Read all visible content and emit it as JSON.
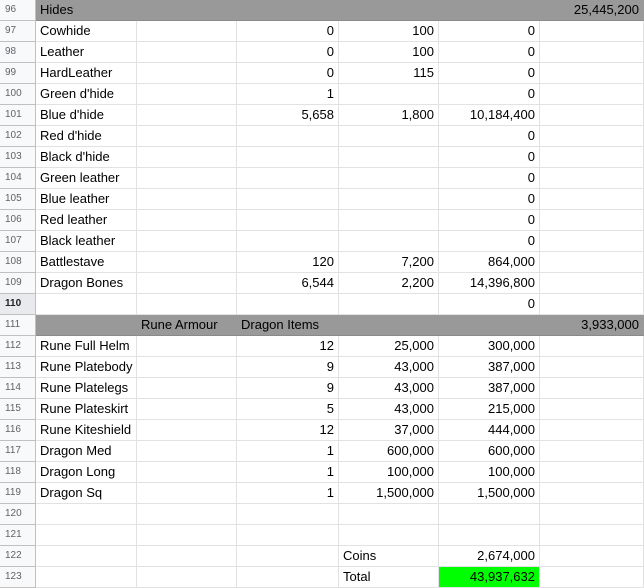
{
  "colors": {
    "header_gray": "#999999",
    "total_green": "#00ff00",
    "gridline": "#e2e2e2"
  },
  "rows": [
    {
      "n": "96",
      "cells": [
        "Hides",
        "",
        "",
        "",
        "",
        "25,445,200"
      ],
      "gray": true
    },
    {
      "n": "97",
      "cells": [
        "Cowhide",
        "",
        "0",
        "100",
        "0",
        ""
      ]
    },
    {
      "n": "98",
      "cells": [
        "Leather",
        "",
        "0",
        "100",
        "0",
        ""
      ]
    },
    {
      "n": "99",
      "cells": [
        "HardLeather",
        "",
        "0",
        "115",
        "0",
        ""
      ]
    },
    {
      "n": "100",
      "cells": [
        "Green d'hide",
        "",
        "1",
        "",
        "0",
        ""
      ]
    },
    {
      "n": "101",
      "cells": [
        "Blue d'hide",
        "",
        "5,658",
        "1,800",
        "10,184,400",
        ""
      ]
    },
    {
      "n": "102",
      "cells": [
        "Red d'hide",
        "",
        "",
        "",
        "0",
        ""
      ]
    },
    {
      "n": "103",
      "cells": [
        "Black d'hide",
        "",
        "",
        "",
        "0",
        ""
      ]
    },
    {
      "n": "104",
      "cells": [
        "Green leather",
        "",
        "",
        "",
        "0",
        ""
      ]
    },
    {
      "n": "105",
      "cells": [
        "Blue leather",
        "",
        "",
        "",
        "0",
        ""
      ]
    },
    {
      "n": "106",
      "cells": [
        "Red leather",
        "",
        "",
        "",
        "0",
        ""
      ]
    },
    {
      "n": "107",
      "cells": [
        "Black leather",
        "",
        "",
        "",
        "0",
        ""
      ]
    },
    {
      "n": "108",
      "cells": [
        "Battlestave",
        "",
        "120",
        "7,200",
        "864,000",
        ""
      ]
    },
    {
      "n": "109",
      "cells": [
        "Dragon Bones",
        "",
        "6,544",
        "2,200",
        "14,396,800",
        ""
      ]
    },
    {
      "n": "110",
      "cells": [
        "",
        "",
        "",
        "",
        "0",
        ""
      ],
      "selected": true
    },
    {
      "n": "111",
      "cells": [
        "",
        "Rune Armour",
        "Dragon Items",
        "",
        "",
        "3,933,000"
      ],
      "gray": true
    },
    {
      "n": "112",
      "cells": [
        "Rune Full Helm",
        "",
        "12",
        "25,000",
        "300,000",
        ""
      ]
    },
    {
      "n": "113",
      "cells": [
        "Rune Platebody",
        "",
        "9",
        "43,000",
        "387,000",
        ""
      ]
    },
    {
      "n": "114",
      "cells": [
        "Rune Platelegs",
        "",
        "9",
        "43,000",
        "387,000",
        ""
      ]
    },
    {
      "n": "115",
      "cells": [
        "Rune Plateskirt",
        "",
        "5",
        "43,000",
        "215,000",
        ""
      ]
    },
    {
      "n": "116",
      "cells": [
        "Rune Kiteshield",
        "",
        "12",
        "37,000",
        "444,000",
        ""
      ]
    },
    {
      "n": "117",
      "cells": [
        "Dragon Med",
        "",
        "1",
        "600,000",
        "600,000",
        ""
      ]
    },
    {
      "n": "118",
      "cells": [
        "Dragon Long",
        "",
        "1",
        "100,000",
        "100,000",
        ""
      ]
    },
    {
      "n": "119",
      "cells": [
        "Dragon Sq",
        "",
        "1",
        "1,500,000",
        "1,500,000",
        ""
      ]
    },
    {
      "n": "120",
      "cells": [
        "",
        "",
        "",
        "",
        "",
        ""
      ]
    },
    {
      "n": "121",
      "cells": [
        "",
        "",
        "",
        "",
        "",
        ""
      ]
    },
    {
      "n": "122",
      "cells": [
        "",
        "",
        "",
        "Coins",
        "2,674,000",
        ""
      ]
    },
    {
      "n": "123",
      "cells": [
        "",
        "",
        "",
        "Total",
        "43,937,632",
        ""
      ],
      "green": 4
    }
  ]
}
